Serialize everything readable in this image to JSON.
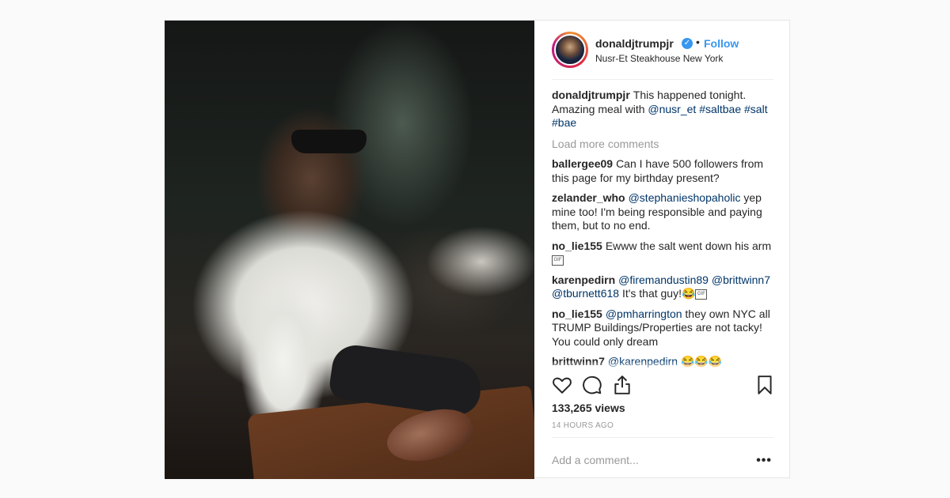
{
  "post": {
    "username": "donaldjtrumpjr",
    "follow_label": "Follow",
    "separator": "•",
    "location": "Nusr-Et Steakhouse New York",
    "caption": {
      "user": "donaldjtrumpjr",
      "text": "This happened tonight. Amazing meal with",
      "mention": "@nusr_et",
      "hashtags": "#saltbae #salt #bae"
    },
    "load_more_label": "Load more comments",
    "comments": [
      {
        "user": "ballergee09",
        "mention": "",
        "text": "Can I have 500 followers from this page for my birthday present?",
        "suffix": ""
      },
      {
        "user": "zelander_who",
        "mention": "@stephanieshopaholic",
        "text": "yep mine too! I'm being responsible and paying them, but to no end.",
        "suffix": ""
      },
      {
        "user": "no_lie155",
        "mention": "",
        "text": "Ewww the salt went down his arm",
        "suffix": ""
      },
      {
        "user": "karenpedirn",
        "mention": "@firemandustin89 @brittwinn7 @tburnett618",
        "text": "It's that guy!😂",
        "suffix": ""
      },
      {
        "user": "no_lie155",
        "mention": "@pmharrington",
        "text": "they own NYC all TRUMP Buildings/Properties are not tacky! You could only dream",
        "suffix": ""
      },
      {
        "user": "brittwinn7",
        "mention": "@karenpedirn",
        "text": "😂😂😂",
        "suffix": ""
      }
    ],
    "gif_label": "GIF",
    "views": "133,265 views",
    "timestamp": "14 HOURS AGO",
    "comment_placeholder": "Add a comment...",
    "more_label": "•••"
  },
  "icons": [
    "heart-icon",
    "comment-icon",
    "share-icon",
    "bookmark-icon",
    "verified-icon",
    "more-options-icon"
  ],
  "colors": {
    "link": "#3897f0",
    "tag": "#003569",
    "muted": "#999999",
    "text": "#262626"
  }
}
